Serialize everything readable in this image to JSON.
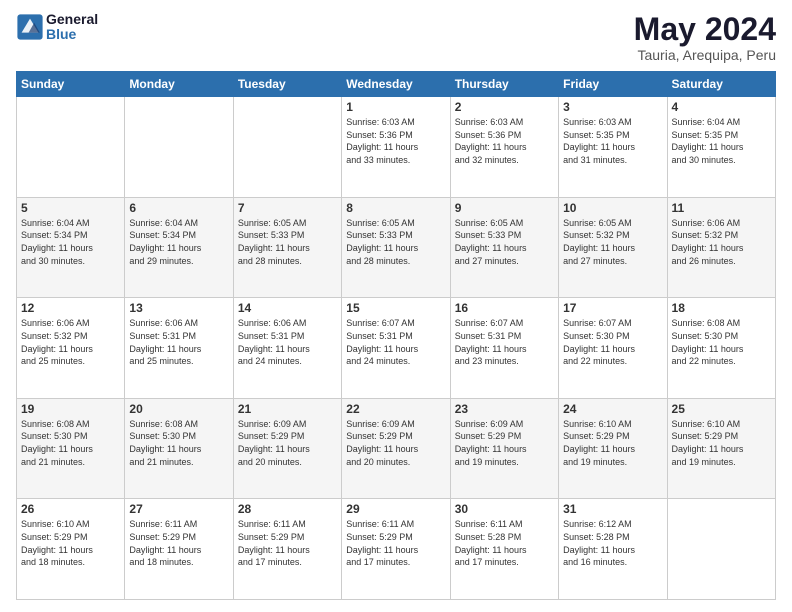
{
  "header": {
    "logo_line1": "General",
    "logo_line2": "Blue",
    "month_year": "May 2024",
    "location": "Tauria, Arequipa, Peru"
  },
  "days_of_week": [
    "Sunday",
    "Monday",
    "Tuesday",
    "Wednesday",
    "Thursday",
    "Friday",
    "Saturday"
  ],
  "weeks": [
    [
      {
        "day": "",
        "info": ""
      },
      {
        "day": "",
        "info": ""
      },
      {
        "day": "",
        "info": ""
      },
      {
        "day": "1",
        "info": "Sunrise: 6:03 AM\nSunset: 5:36 PM\nDaylight: 11 hours\nand 33 minutes."
      },
      {
        "day": "2",
        "info": "Sunrise: 6:03 AM\nSunset: 5:36 PM\nDaylight: 11 hours\nand 32 minutes."
      },
      {
        "day": "3",
        "info": "Sunrise: 6:03 AM\nSunset: 5:35 PM\nDaylight: 11 hours\nand 31 minutes."
      },
      {
        "day": "4",
        "info": "Sunrise: 6:04 AM\nSunset: 5:35 PM\nDaylight: 11 hours\nand 30 minutes."
      }
    ],
    [
      {
        "day": "5",
        "info": "Sunrise: 6:04 AM\nSunset: 5:34 PM\nDaylight: 11 hours\nand 30 minutes."
      },
      {
        "day": "6",
        "info": "Sunrise: 6:04 AM\nSunset: 5:34 PM\nDaylight: 11 hours\nand 29 minutes."
      },
      {
        "day": "7",
        "info": "Sunrise: 6:05 AM\nSunset: 5:33 PM\nDaylight: 11 hours\nand 28 minutes."
      },
      {
        "day": "8",
        "info": "Sunrise: 6:05 AM\nSunset: 5:33 PM\nDaylight: 11 hours\nand 28 minutes."
      },
      {
        "day": "9",
        "info": "Sunrise: 6:05 AM\nSunset: 5:33 PM\nDaylight: 11 hours\nand 27 minutes."
      },
      {
        "day": "10",
        "info": "Sunrise: 6:05 AM\nSunset: 5:32 PM\nDaylight: 11 hours\nand 27 minutes."
      },
      {
        "day": "11",
        "info": "Sunrise: 6:06 AM\nSunset: 5:32 PM\nDaylight: 11 hours\nand 26 minutes."
      }
    ],
    [
      {
        "day": "12",
        "info": "Sunrise: 6:06 AM\nSunset: 5:32 PM\nDaylight: 11 hours\nand 25 minutes."
      },
      {
        "day": "13",
        "info": "Sunrise: 6:06 AM\nSunset: 5:31 PM\nDaylight: 11 hours\nand 25 minutes."
      },
      {
        "day": "14",
        "info": "Sunrise: 6:06 AM\nSunset: 5:31 PM\nDaylight: 11 hours\nand 24 minutes."
      },
      {
        "day": "15",
        "info": "Sunrise: 6:07 AM\nSunset: 5:31 PM\nDaylight: 11 hours\nand 24 minutes."
      },
      {
        "day": "16",
        "info": "Sunrise: 6:07 AM\nSunset: 5:31 PM\nDaylight: 11 hours\nand 23 minutes."
      },
      {
        "day": "17",
        "info": "Sunrise: 6:07 AM\nSunset: 5:30 PM\nDaylight: 11 hours\nand 22 minutes."
      },
      {
        "day": "18",
        "info": "Sunrise: 6:08 AM\nSunset: 5:30 PM\nDaylight: 11 hours\nand 22 minutes."
      }
    ],
    [
      {
        "day": "19",
        "info": "Sunrise: 6:08 AM\nSunset: 5:30 PM\nDaylight: 11 hours\nand 21 minutes."
      },
      {
        "day": "20",
        "info": "Sunrise: 6:08 AM\nSunset: 5:30 PM\nDaylight: 11 hours\nand 21 minutes."
      },
      {
        "day": "21",
        "info": "Sunrise: 6:09 AM\nSunset: 5:29 PM\nDaylight: 11 hours\nand 20 minutes."
      },
      {
        "day": "22",
        "info": "Sunrise: 6:09 AM\nSunset: 5:29 PM\nDaylight: 11 hours\nand 20 minutes."
      },
      {
        "day": "23",
        "info": "Sunrise: 6:09 AM\nSunset: 5:29 PM\nDaylight: 11 hours\nand 19 minutes."
      },
      {
        "day": "24",
        "info": "Sunrise: 6:10 AM\nSunset: 5:29 PM\nDaylight: 11 hours\nand 19 minutes."
      },
      {
        "day": "25",
        "info": "Sunrise: 6:10 AM\nSunset: 5:29 PM\nDaylight: 11 hours\nand 19 minutes."
      }
    ],
    [
      {
        "day": "26",
        "info": "Sunrise: 6:10 AM\nSunset: 5:29 PM\nDaylight: 11 hours\nand 18 minutes."
      },
      {
        "day": "27",
        "info": "Sunrise: 6:11 AM\nSunset: 5:29 PM\nDaylight: 11 hours\nand 18 minutes."
      },
      {
        "day": "28",
        "info": "Sunrise: 6:11 AM\nSunset: 5:29 PM\nDaylight: 11 hours\nand 17 minutes."
      },
      {
        "day": "29",
        "info": "Sunrise: 6:11 AM\nSunset: 5:29 PM\nDaylight: 11 hours\nand 17 minutes."
      },
      {
        "day": "30",
        "info": "Sunrise: 6:11 AM\nSunset: 5:28 PM\nDaylight: 11 hours\nand 17 minutes."
      },
      {
        "day": "31",
        "info": "Sunrise: 6:12 AM\nSunset: 5:28 PM\nDaylight: 11 hours\nand 16 minutes."
      },
      {
        "day": "",
        "info": ""
      }
    ]
  ]
}
